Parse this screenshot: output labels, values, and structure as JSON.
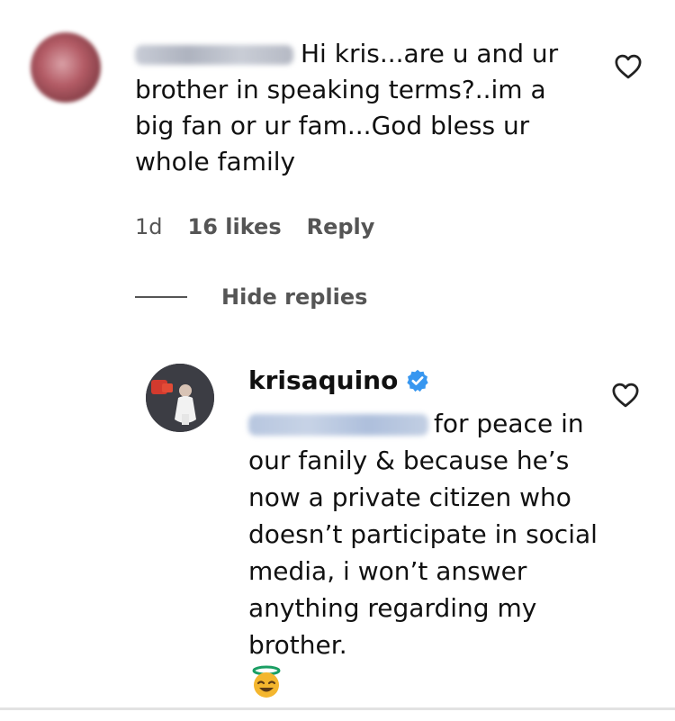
{
  "comment": {
    "username_blurred": "riza.quinsay",
    "text": "Hi kris...are u and ur brother in speaking terms?..im a big fan or ur fam...God bless ur whole family",
    "time": "1d",
    "likes": "16 likes",
    "reply_label": "Reply",
    "hide_replies_label": "Hide replies"
  },
  "reply": {
    "username": "krisaquino",
    "mention_blurred": "@riza.quinsay",
    "text": "for peace in our fanily & because he’s now a private citizen who doesn’t participate in social media, i won’t answer anything regarding my brother."
  },
  "colors": {
    "verified_blue": "#3897f0",
    "meta_gray": "#555555",
    "text": "#111111"
  },
  "icons": {
    "like": "heart-outline-icon",
    "verified": "verified-badge-icon",
    "emoji": "halo-smile-emoji"
  }
}
